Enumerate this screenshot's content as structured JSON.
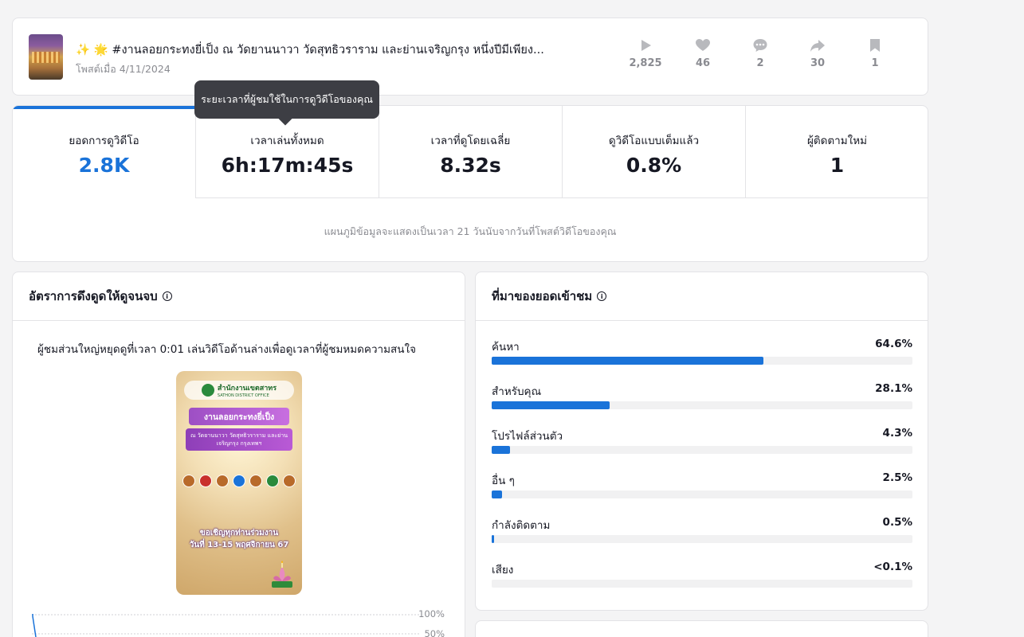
{
  "post": {
    "title_emoji": "✨ 🌟",
    "title": "#งานลอยกระทงยี่เป็ง ณ วัดยานนาวา วัดสุทธิวราราม และย่านเจริญกรุง หนึ่งปีมีเพียง...",
    "date": "โพสต์เมื่อ 4/11/2024",
    "stats": [
      {
        "icon": "play-icon",
        "value": "2,825"
      },
      {
        "icon": "heart-icon",
        "value": "46"
      },
      {
        "icon": "comment-icon",
        "value": "2"
      },
      {
        "icon": "share-icon",
        "value": "30"
      },
      {
        "icon": "bookmark-icon",
        "value": "1"
      }
    ]
  },
  "metrics": {
    "items": [
      {
        "label": "ยอดการดูวิดีโอ",
        "value": "2.8K"
      },
      {
        "label": "เวลาเล่นทั้งหมด",
        "value": "6h:17m:45s"
      },
      {
        "label": "เวลาที่ดูโดยเฉลี่ย",
        "value": "8.32s"
      },
      {
        "label": "ดูวิดีโอแบบเต็มแล้ว",
        "value": "0.8%"
      },
      {
        "label": "ผู้ติดตามใหม่",
        "value": "1"
      }
    ],
    "tooltip": "ระยะเวลาที่ผู้ชมใช้ในการดูวิดีโอของคุณ",
    "note": "แผนภูมิข้อมูลจะแสดงเป็นเวลา 21 วันนับจากวันที่โพสต์วิดีโอของคุณ"
  },
  "retention": {
    "title": "อัตราการดึงดูดให้ดูจนจบ",
    "description": "ผู้ชมส่วนใหญ่หยุดดูที่เวลา 0:01 เล่นวิดีโอด้านล่างเพื่อดูเวลาที่ผู้ชมหมดความสนใจ",
    "video": {
      "office": "สำนักงานเขตสาทร",
      "office_en": "SATHON DISTRICT OFFICE",
      "headline": "งานลอยกระทงยี่เป็ง",
      "subline": "ณ วัดยานนาวา วัดสุทธิวราราม และย่านเจริญกรุง กรุงเทพฯ",
      "invite1": "ขอเชิญทุกท่านร่วมงาน",
      "invite2": "วันที่ 13-15 พฤศจิกายน 67"
    },
    "y_ticks": [
      "100%",
      "50%"
    ]
  },
  "traffic": {
    "title": "ที่มาของยอดเข้าชม",
    "sources": [
      {
        "name": "ค้นหา",
        "pct": "64.6%",
        "fraction": 0.646
      },
      {
        "name": "สำหรับคุณ",
        "pct": "28.1%",
        "fraction": 0.281
      },
      {
        "name": "โปรไฟล์ส่วนตัว",
        "pct": "4.3%",
        "fraction": 0.043
      },
      {
        "name": "อื่น ๆ",
        "pct": "2.5%",
        "fraction": 0.025
      },
      {
        "name": "กำลังติดตาม",
        "pct": "0.5%",
        "fraction": 0.005
      },
      {
        "name": "เสียง",
        "pct": "<0.1%",
        "fraction": 0.0
      }
    ]
  },
  "colors": {
    "accent": "#1a73d9",
    "muted": "#8a8b91"
  }
}
